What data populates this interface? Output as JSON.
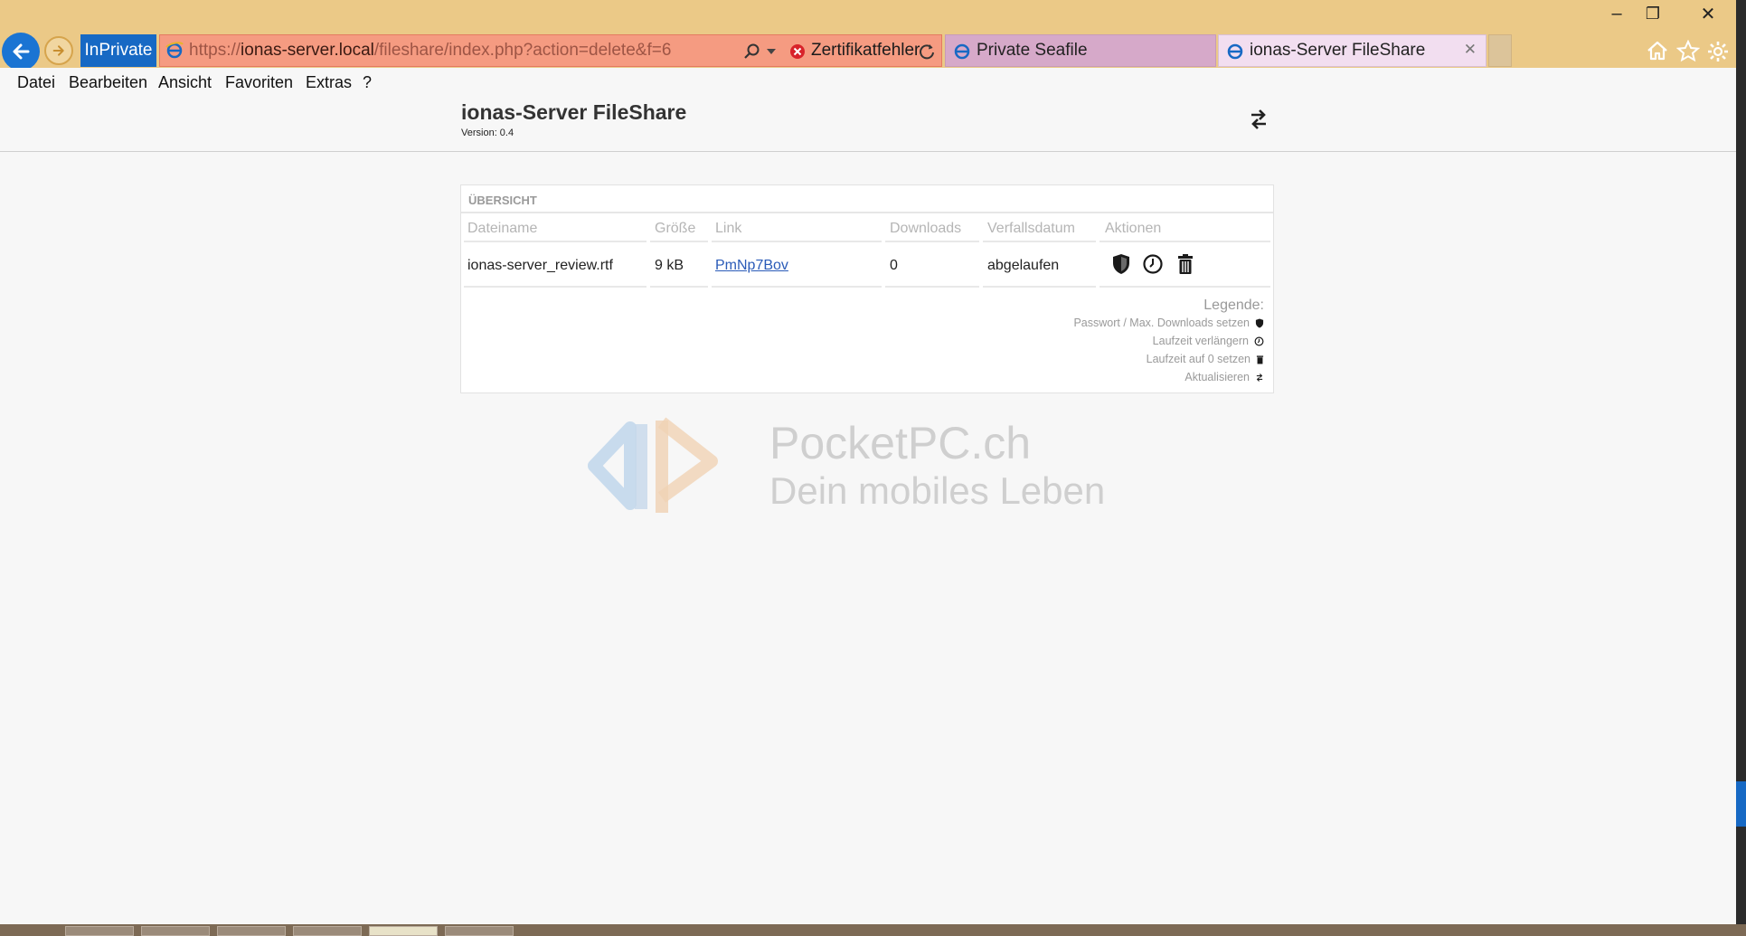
{
  "window": {
    "controls": {
      "minimize": "–",
      "restore": "❐",
      "close": "✕"
    }
  },
  "browser": {
    "inprivate_label": "InPrivate",
    "address": {
      "scheme": "https://",
      "host": "ionas-server.local",
      "path": "/fileshare/index.php?action=delete&f=6",
      "cert_error": "Zertifikatfehler"
    },
    "tabs": [
      {
        "label": "Private Seafile",
        "active": false
      },
      {
        "label": "ionas-Server FileShare",
        "active": true
      }
    ],
    "tab_close": "✕",
    "toolbar_icons": [
      "home-icon",
      "favorites-star-icon",
      "settings-gear-icon"
    ]
  },
  "menu": {
    "items": [
      "Datei",
      "Bearbeiten",
      "Ansicht",
      "Favoriten",
      "Extras",
      "?"
    ]
  },
  "header": {
    "title": "ionas-Server FileShare",
    "version": "Version: 0.4"
  },
  "overview": {
    "heading": "ÜBERSICHT",
    "columns": [
      "Dateiname",
      "Größe",
      "Link",
      "Downloads",
      "Verfallsdatum",
      "Aktionen"
    ],
    "rows": [
      {
        "filename": "ionas-server_review.rtf",
        "size": "9 kB",
        "link": "PmNp7Bov",
        "downloads": "0",
        "expiry": "abgelaufen"
      }
    ],
    "legend": {
      "title": "Legende:",
      "items": [
        {
          "label": "Passwort / Max. Downloads setzen",
          "icon": "shield-icon"
        },
        {
          "label": "Laufzeit verlängern",
          "icon": "clock-icon"
        },
        {
          "label": "Laufzeit auf 0 setzen",
          "icon": "trash-icon"
        },
        {
          "label": "Aktualisieren",
          "icon": "refresh-icon"
        }
      ]
    }
  },
  "watermark": {
    "line1": "PocketPC.ch",
    "line2": "Dein mobiles Leben"
  },
  "colors": {
    "chrome_bg": "#ebc987",
    "address_bar_error": "#f59b81",
    "inprivate_blue": "#1769c4",
    "link_blue": "#2a5bb8"
  }
}
